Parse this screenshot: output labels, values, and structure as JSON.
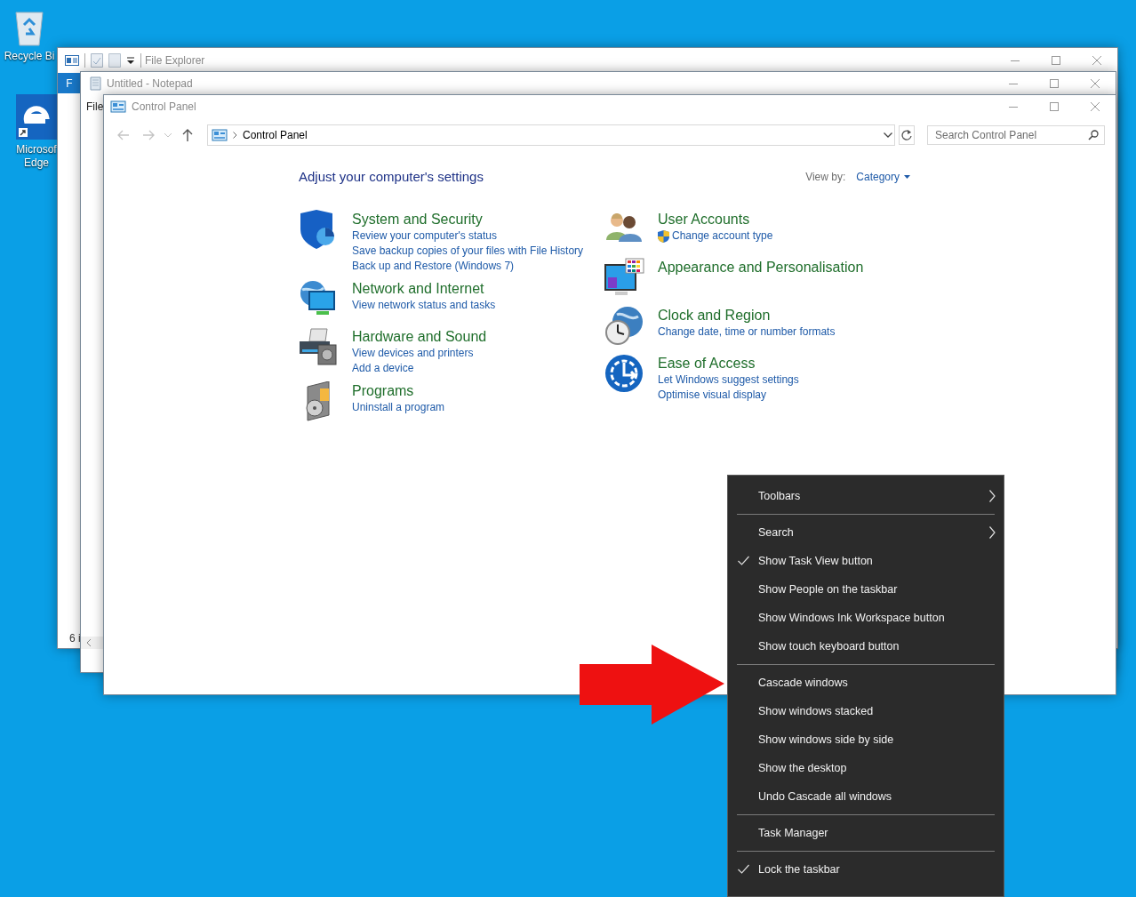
{
  "desktop": {
    "icons": [
      {
        "kind": "recycle-bin",
        "label_lines": [
          "Recycle Bi"
        ]
      },
      {
        "kind": "browser",
        "label_lines": [
          "Microsof",
          "Edge"
        ]
      }
    ]
  },
  "windows": [
    {
      "kind": "explorer",
      "title": "File Explorer",
      "ribbon_tab": "F",
      "status_text": "6 i"
    },
    {
      "kind": "notepad",
      "title": "Untitled - Notepad",
      "menu": [
        "File"
      ]
    },
    {
      "kind": "control-panel",
      "title": "Control Panel",
      "breadcrumb": "Control Panel",
      "search": {
        "placeholder": "Search Control Panel"
      },
      "heading": "Adjust your computer's settings",
      "view_by": {
        "label": "View by:",
        "value": "Category"
      },
      "columns": [
        {
          "categories": [
            {
              "kind": "security",
              "title": "System and Security",
              "links": [
                {
                  "kind": "plain",
                  "text": "Review your computer's status"
                },
                {
                  "kind": "plain",
                  "text": "Save backup copies of your files with File History"
                },
                {
                  "kind": "plain",
                  "text": "Back up and Restore (Windows 7)"
                }
              ]
            },
            {
              "kind": "network",
              "title": "Network and Internet",
              "links": [
                {
                  "kind": "plain",
                  "text": "View network status and tasks"
                }
              ]
            },
            {
              "kind": "hardware",
              "title": "Hardware and Sound",
              "links": [
                {
                  "kind": "plain",
                  "text": "View devices and printers"
                },
                {
                  "kind": "plain",
                  "text": "Add a device"
                }
              ]
            },
            {
              "kind": "programs",
              "title": "Programs",
              "links": [
                {
                  "kind": "plain",
                  "text": "Uninstall a program"
                }
              ]
            }
          ]
        },
        {
          "categories": [
            {
              "kind": "users",
              "title": "User Accounts",
              "links": [
                {
                  "kind": "admin",
                  "text": "Change account type"
                }
              ]
            },
            {
              "kind": "appearance",
              "title": "Appearance and Personalisation"
            },
            {
              "kind": "clock",
              "title": "Clock and Region",
              "links": [
                {
                  "kind": "plain",
                  "text": "Change date, time or number formats"
                }
              ]
            },
            {
              "kind": "access",
              "title": "Ease of Access",
              "links": [
                {
                  "kind": "plain",
                  "text": "Let Windows suggest settings"
                },
                {
                  "kind": "plain",
                  "text": "Optimise visual display"
                }
              ]
            }
          ]
        }
      ]
    }
  ],
  "context_menu": {
    "items": [
      {
        "kind": "submenu",
        "label": "Toolbars"
      },
      {
        "kind": "separator"
      },
      {
        "kind": "submenu",
        "label": "Search"
      },
      {
        "kind": "check",
        "label": "Show Task View button",
        "checked": true
      },
      {
        "kind": "check",
        "label": "Show People on the taskbar",
        "checked": false
      },
      {
        "kind": "check",
        "label": "Show Windows Ink Workspace button",
        "checked": false
      },
      {
        "kind": "check",
        "label": "Show touch keyboard button",
        "checked": false
      },
      {
        "kind": "separator"
      },
      {
        "kind": "action",
        "label": "Cascade windows"
      },
      {
        "kind": "action",
        "label": "Show windows stacked"
      },
      {
        "kind": "action",
        "label": "Show windows side by side"
      },
      {
        "kind": "action",
        "label": "Show the desktop"
      },
      {
        "kind": "action",
        "label": "Undo Cascade all windows"
      },
      {
        "kind": "separator"
      },
      {
        "kind": "action",
        "label": "Task Manager"
      },
      {
        "kind": "separator"
      },
      {
        "kind": "check",
        "label": "Lock the taskbar",
        "checked": true
      }
    ]
  },
  "overlay": {
    "kind": "arrow"
  }
}
